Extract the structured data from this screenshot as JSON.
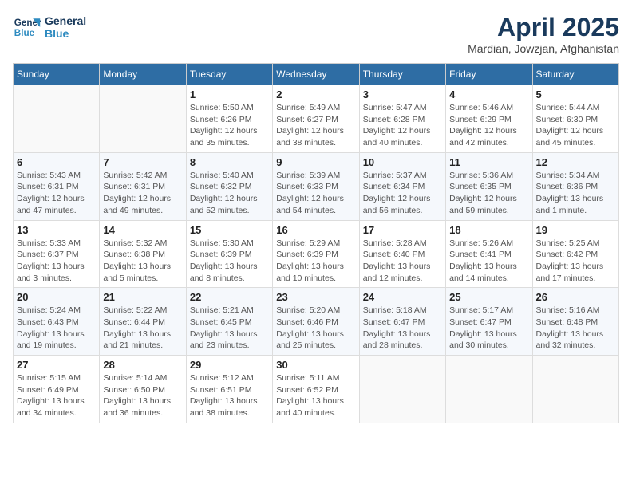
{
  "logo": {
    "line1": "General",
    "line2": "Blue"
  },
  "title": "April 2025",
  "subtitle": "Mardian, Jowzjan, Afghanistan",
  "days": [
    "Sunday",
    "Monday",
    "Tuesday",
    "Wednesday",
    "Thursday",
    "Friday",
    "Saturday"
  ],
  "weeks": [
    [
      {
        "date": "",
        "info": ""
      },
      {
        "date": "",
        "info": ""
      },
      {
        "date": "1",
        "info": "Sunrise: 5:50 AM\nSunset: 6:26 PM\nDaylight: 12 hours and 35 minutes."
      },
      {
        "date": "2",
        "info": "Sunrise: 5:49 AM\nSunset: 6:27 PM\nDaylight: 12 hours and 38 minutes."
      },
      {
        "date": "3",
        "info": "Sunrise: 5:47 AM\nSunset: 6:28 PM\nDaylight: 12 hours and 40 minutes."
      },
      {
        "date": "4",
        "info": "Sunrise: 5:46 AM\nSunset: 6:29 PM\nDaylight: 12 hours and 42 minutes."
      },
      {
        "date": "5",
        "info": "Sunrise: 5:44 AM\nSunset: 6:30 PM\nDaylight: 12 hours and 45 minutes."
      }
    ],
    [
      {
        "date": "6",
        "info": "Sunrise: 5:43 AM\nSunset: 6:31 PM\nDaylight: 12 hours and 47 minutes."
      },
      {
        "date": "7",
        "info": "Sunrise: 5:42 AM\nSunset: 6:31 PM\nDaylight: 12 hours and 49 minutes."
      },
      {
        "date": "8",
        "info": "Sunrise: 5:40 AM\nSunset: 6:32 PM\nDaylight: 12 hours and 52 minutes."
      },
      {
        "date": "9",
        "info": "Sunrise: 5:39 AM\nSunset: 6:33 PM\nDaylight: 12 hours and 54 minutes."
      },
      {
        "date": "10",
        "info": "Sunrise: 5:37 AM\nSunset: 6:34 PM\nDaylight: 12 hours and 56 minutes."
      },
      {
        "date": "11",
        "info": "Sunrise: 5:36 AM\nSunset: 6:35 PM\nDaylight: 12 hours and 59 minutes."
      },
      {
        "date": "12",
        "info": "Sunrise: 5:34 AM\nSunset: 6:36 PM\nDaylight: 13 hours and 1 minute."
      }
    ],
    [
      {
        "date": "13",
        "info": "Sunrise: 5:33 AM\nSunset: 6:37 PM\nDaylight: 13 hours and 3 minutes."
      },
      {
        "date": "14",
        "info": "Sunrise: 5:32 AM\nSunset: 6:38 PM\nDaylight: 13 hours and 5 minutes."
      },
      {
        "date": "15",
        "info": "Sunrise: 5:30 AM\nSunset: 6:39 PM\nDaylight: 13 hours and 8 minutes."
      },
      {
        "date": "16",
        "info": "Sunrise: 5:29 AM\nSunset: 6:39 PM\nDaylight: 13 hours and 10 minutes."
      },
      {
        "date": "17",
        "info": "Sunrise: 5:28 AM\nSunset: 6:40 PM\nDaylight: 13 hours and 12 minutes."
      },
      {
        "date": "18",
        "info": "Sunrise: 5:26 AM\nSunset: 6:41 PM\nDaylight: 13 hours and 14 minutes."
      },
      {
        "date": "19",
        "info": "Sunrise: 5:25 AM\nSunset: 6:42 PM\nDaylight: 13 hours and 17 minutes."
      }
    ],
    [
      {
        "date": "20",
        "info": "Sunrise: 5:24 AM\nSunset: 6:43 PM\nDaylight: 13 hours and 19 minutes."
      },
      {
        "date": "21",
        "info": "Sunrise: 5:22 AM\nSunset: 6:44 PM\nDaylight: 13 hours and 21 minutes."
      },
      {
        "date": "22",
        "info": "Sunrise: 5:21 AM\nSunset: 6:45 PM\nDaylight: 13 hours and 23 minutes."
      },
      {
        "date": "23",
        "info": "Sunrise: 5:20 AM\nSunset: 6:46 PM\nDaylight: 13 hours and 25 minutes."
      },
      {
        "date": "24",
        "info": "Sunrise: 5:18 AM\nSunset: 6:47 PM\nDaylight: 13 hours and 28 minutes."
      },
      {
        "date": "25",
        "info": "Sunrise: 5:17 AM\nSunset: 6:47 PM\nDaylight: 13 hours and 30 minutes."
      },
      {
        "date": "26",
        "info": "Sunrise: 5:16 AM\nSunset: 6:48 PM\nDaylight: 13 hours and 32 minutes."
      }
    ],
    [
      {
        "date": "27",
        "info": "Sunrise: 5:15 AM\nSunset: 6:49 PM\nDaylight: 13 hours and 34 minutes."
      },
      {
        "date": "28",
        "info": "Sunrise: 5:14 AM\nSunset: 6:50 PM\nDaylight: 13 hours and 36 minutes."
      },
      {
        "date": "29",
        "info": "Sunrise: 5:12 AM\nSunset: 6:51 PM\nDaylight: 13 hours and 38 minutes."
      },
      {
        "date": "30",
        "info": "Sunrise: 5:11 AM\nSunset: 6:52 PM\nDaylight: 13 hours and 40 minutes."
      },
      {
        "date": "",
        "info": ""
      },
      {
        "date": "",
        "info": ""
      },
      {
        "date": "",
        "info": ""
      }
    ]
  ]
}
